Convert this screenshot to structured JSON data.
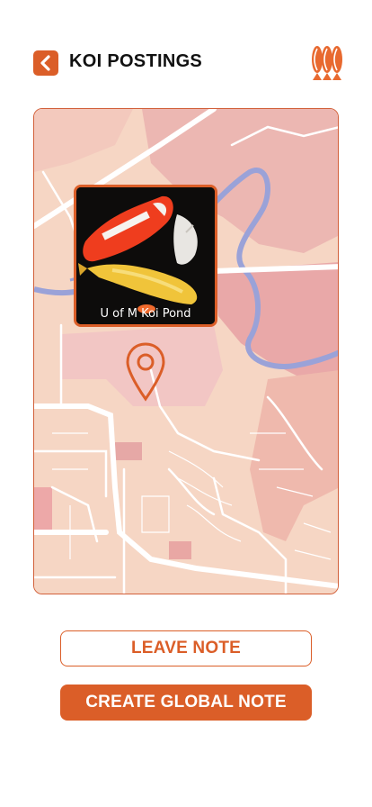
{
  "header": {
    "title": "KOI POSTINGS",
    "back_icon": "chevron-left-icon",
    "logo_icon": "koi-logo-icon"
  },
  "map": {
    "location_label": "U of M Koi Pond",
    "pin_icon": "map-pin-icon"
  },
  "actions": {
    "leave_note": "LEAVE NOTE",
    "create_global_note": "CREATE GLOBAL NOTE"
  },
  "colors": {
    "accent": "#db5e28",
    "map_base": "#f6d6c4",
    "map_zone": "#ecb7b2",
    "river": "#9aa2d8"
  }
}
